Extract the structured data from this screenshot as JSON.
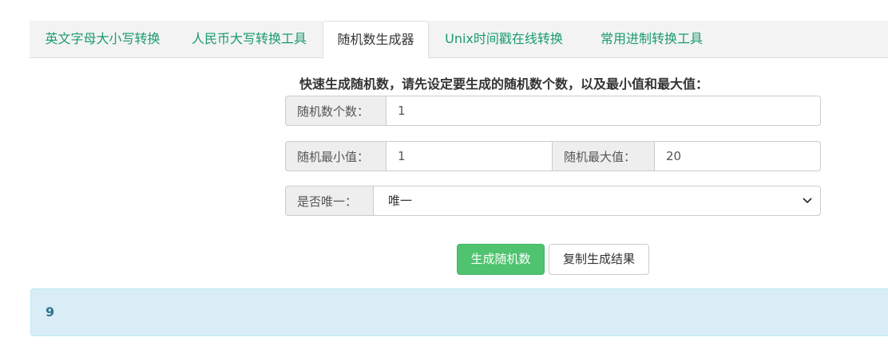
{
  "tabs": [
    {
      "label": "英文字母大小写转换"
    },
    {
      "label": "人民币大写转换工具"
    },
    {
      "label": "随机数生成器"
    },
    {
      "label": "Unix时间戳在线转换"
    },
    {
      "label": "常用进制转换工具"
    }
  ],
  "active_tab": "随机数生成器",
  "instruction": "快速生成随机数，请先设定要生成的随机数个数，以及最小值和最大值：",
  "count_field": {
    "label": "随机数个数：",
    "value": "1"
  },
  "min_field": {
    "label": "随机最小值：",
    "value": "1"
  },
  "max_field": {
    "label": "随机最大值：",
    "value": "20"
  },
  "unique_field": {
    "label": "是否唯一：",
    "selected": "唯一"
  },
  "buttons": {
    "generate": "生成随机数",
    "copy": "复制生成结果"
  },
  "result": {
    "value": "9"
  },
  "colors": {
    "tab_text": "#1a9b6e",
    "primary_button": "#4fc36f",
    "result_bg": "#d9edf7",
    "result_text": "#31708f"
  },
  "icons": {
    "select_arrow": "chevron-down-icon"
  }
}
